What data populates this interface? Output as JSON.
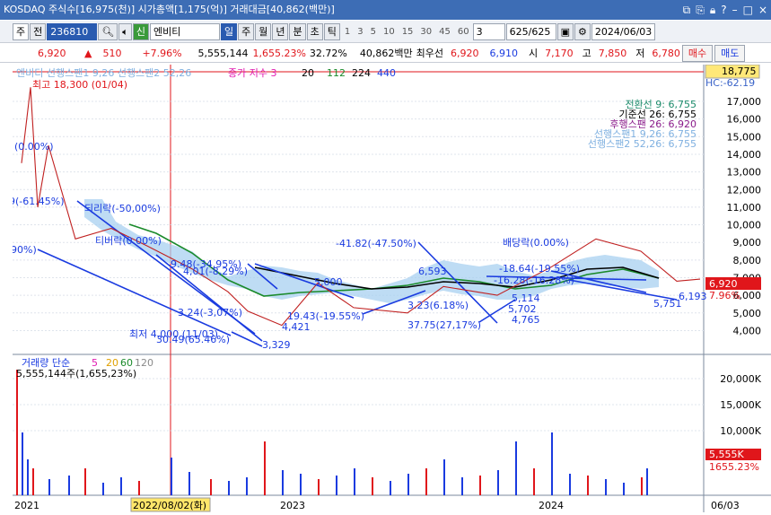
{
  "titlebar": {
    "text": "KOSDAQ 주식수[16,975(천)] 시가총액[1,175(억)] 거래대금[40,862(백만)]",
    "icons": [
      "layout-icon",
      "copy-icon",
      "lock-icon",
      "help-icon",
      "minimize-icon",
      "maximize-icon",
      "close-icon"
    ]
  },
  "toolbar": {
    "market": "주",
    "jeon": "전",
    "code": "236810",
    "stock_name": "엔비티",
    "periods": [
      "일",
      "주",
      "월",
      "년",
      "분",
      "초",
      "틱"
    ],
    "numbers": [
      "1",
      "3",
      "5",
      "10",
      "15",
      "30",
      "45",
      "60"
    ],
    "count_sel": "3",
    "range": "625",
    "range_total": "/625",
    "date": "2024/06/03"
  },
  "quote": {
    "price": "6,920",
    "change": "510",
    "pct": "+7.96%",
    "volume": "5,555,144",
    "vol_pct": "1,655.23%",
    "turnover": "32.72%",
    "amount": "40,862백만",
    "best_label": "최우선",
    "best_ask": "6,920",
    "best_bid": "6,910",
    "open_label": "시",
    "open": "7,170",
    "high_label": "고",
    "high": "7,850",
    "low_label": "저",
    "low": "6,780",
    "buy_label": "매수",
    "sell_label": "매도"
  },
  "chart": {
    "top_right_price": "18,775",
    "price_ticks": [
      "17,000",
      "16,000",
      "15,000",
      "14,000",
      "13,000",
      "12,000",
      "11,000",
      "10,000",
      "9,000",
      "8,000",
      "7,000",
      "6,000",
      "5,000",
      "4,000"
    ],
    "current_price_tag": "6,920",
    "current_pct_tag": "7.96%",
    "vol_ticks": [
      "20,000K",
      "15,000K",
      "10,000K"
    ],
    "vol_current": "5,555K",
    "vol_pct": "1655.23%",
    "x_labels": [
      "2021",
      "2022/08/02(화)",
      "2023",
      "2024",
      "06/03"
    ],
    "legend_top": "엔비디  선행스팬1 9,26  선행스팬2 52,26",
    "legend_ma_label": "종가 저수 3",
    "legend_ma_vals": [
      "20",
      "112",
      "224",
      "440"
    ],
    "hc_label": "HC:-62.19",
    "high_label": "최고 18,300 (01/04)",
    "low_label": "최저 4,000 (11/03)",
    "ichimoku": [
      "전환선 9: 6,755",
      "기준선 26: 6,755",
      "후행스팬 26: 6,920",
      "선행스팬1 9,26: 6,755",
      "선행스팬2 52,26: 6,755"
    ],
    "annotations": [
      "(0.00%)",
      "9(-61.45%)",
      "90%)",
      "되리락(-50,00%)",
      "티버락(0.00%)",
      "9.48(-34,95%)",
      "4,01(-8,29%)",
      "3.24(-3,07%)",
      "30.49(65.46%)",
      "4,421",
      "3,329",
      "5,000",
      "19.43(-19.55%)",
      "-41.82(-47.50%)",
      "6,593",
      "3.23(6.18%)",
      "5,114",
      "4,765",
      "37.75(27,17%)",
      "배당락(0.00%)",
      "-18.64(-19.55%)",
      "-16.28(-16.28%)",
      "5,702",
      "6,193",
      "5,751"
    ],
    "volume_legend": "거래량 단순",
    "vol_ma": [
      "5",
      "20",
      "60",
      "120"
    ],
    "volume_line": "5,555,144주(1,655,23%)"
  },
  "chart_data": {
    "type": "line",
    "title": "엔비티",
    "ylim": [
      3500,
      18800
    ],
    "x": [
      "2021",
      "2022/08/02",
      "2023",
      "2024",
      "06/03"
    ],
    "series": [
      {
        "name": "종가",
        "values": [
          13500,
          9200,
          8800,
          7500,
          6200,
          5100,
          4200,
          6800,
          5400,
          5000,
          6500,
          7600,
          9200,
          8500,
          6800,
          7200,
          6920
        ]
      }
    ]
  }
}
